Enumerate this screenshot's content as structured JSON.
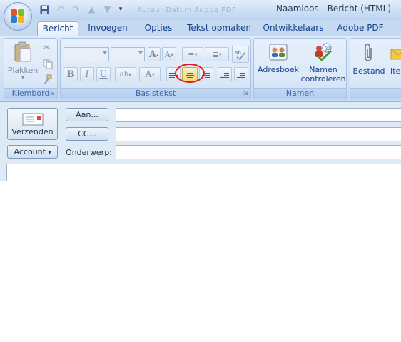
{
  "window": {
    "title": "Naamloos - Bericht (HTML)",
    "ghost_title": "Auteur  Datum  Adobe PDF"
  },
  "tabs": [
    {
      "label": "Bericht",
      "active": true
    },
    {
      "label": "Invoegen",
      "active": false
    },
    {
      "label": "Opties",
      "active": false
    },
    {
      "label": "Tekst opmaken",
      "active": false
    },
    {
      "label": "Ontwikkelaars",
      "active": false
    },
    {
      "label": "Adobe PDF",
      "active": false
    }
  ],
  "ribbon": {
    "klembord": {
      "label": "Klembord",
      "paste_label": "Plakken"
    },
    "basistekst": {
      "label": "Basistekst",
      "bold": "B",
      "italic": "I",
      "underline": "U",
      "grow_font": "A",
      "shrink_font": "A",
      "font_color": "A"
    },
    "namen": {
      "label": "Namen",
      "adresboek": "Adresboek",
      "namen_line1": "Namen",
      "namen_line2": "controleren"
    },
    "invoegen": {
      "bestand": "Bestand",
      "item": "Ite"
    }
  },
  "compose": {
    "send_label": "Verzenden",
    "to_label": "Aan...",
    "cc_label": "CC...",
    "account_label": "Account",
    "subject_label": "Onderwerp:"
  },
  "colors": {
    "accent": "#15428b",
    "highlight_circle": "#e21a1a"
  }
}
